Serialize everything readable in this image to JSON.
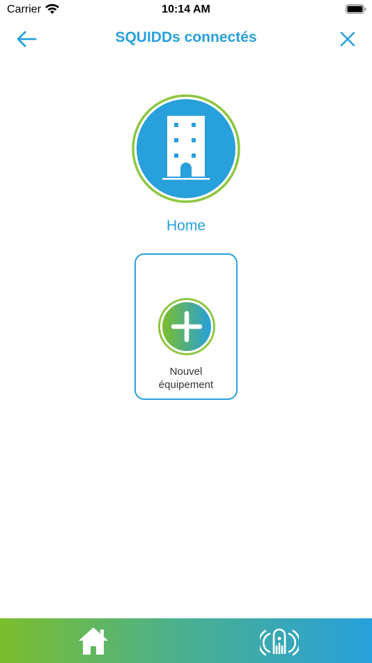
{
  "status_bar": {
    "carrier": "Carrier",
    "time": "10:14 AM"
  },
  "nav": {
    "title": "SQUIDDs connectés",
    "back_icon": "arrow-left-icon",
    "close_icon": "close-icon"
  },
  "place": {
    "label": "Home",
    "icon": "building-icon"
  },
  "new_equipment": {
    "label_line1": "Nouvel",
    "label_line2": "équipement",
    "icon": "plus-icon"
  },
  "tab_bar": {
    "items": [
      {
        "icon": "home-icon"
      },
      {
        "icon": "squidd-device-icon"
      }
    ]
  },
  "colors": {
    "accent_blue": "#27a0db",
    "accent_green": "#7cbd2c",
    "ring_green": "#8dc63f"
  }
}
